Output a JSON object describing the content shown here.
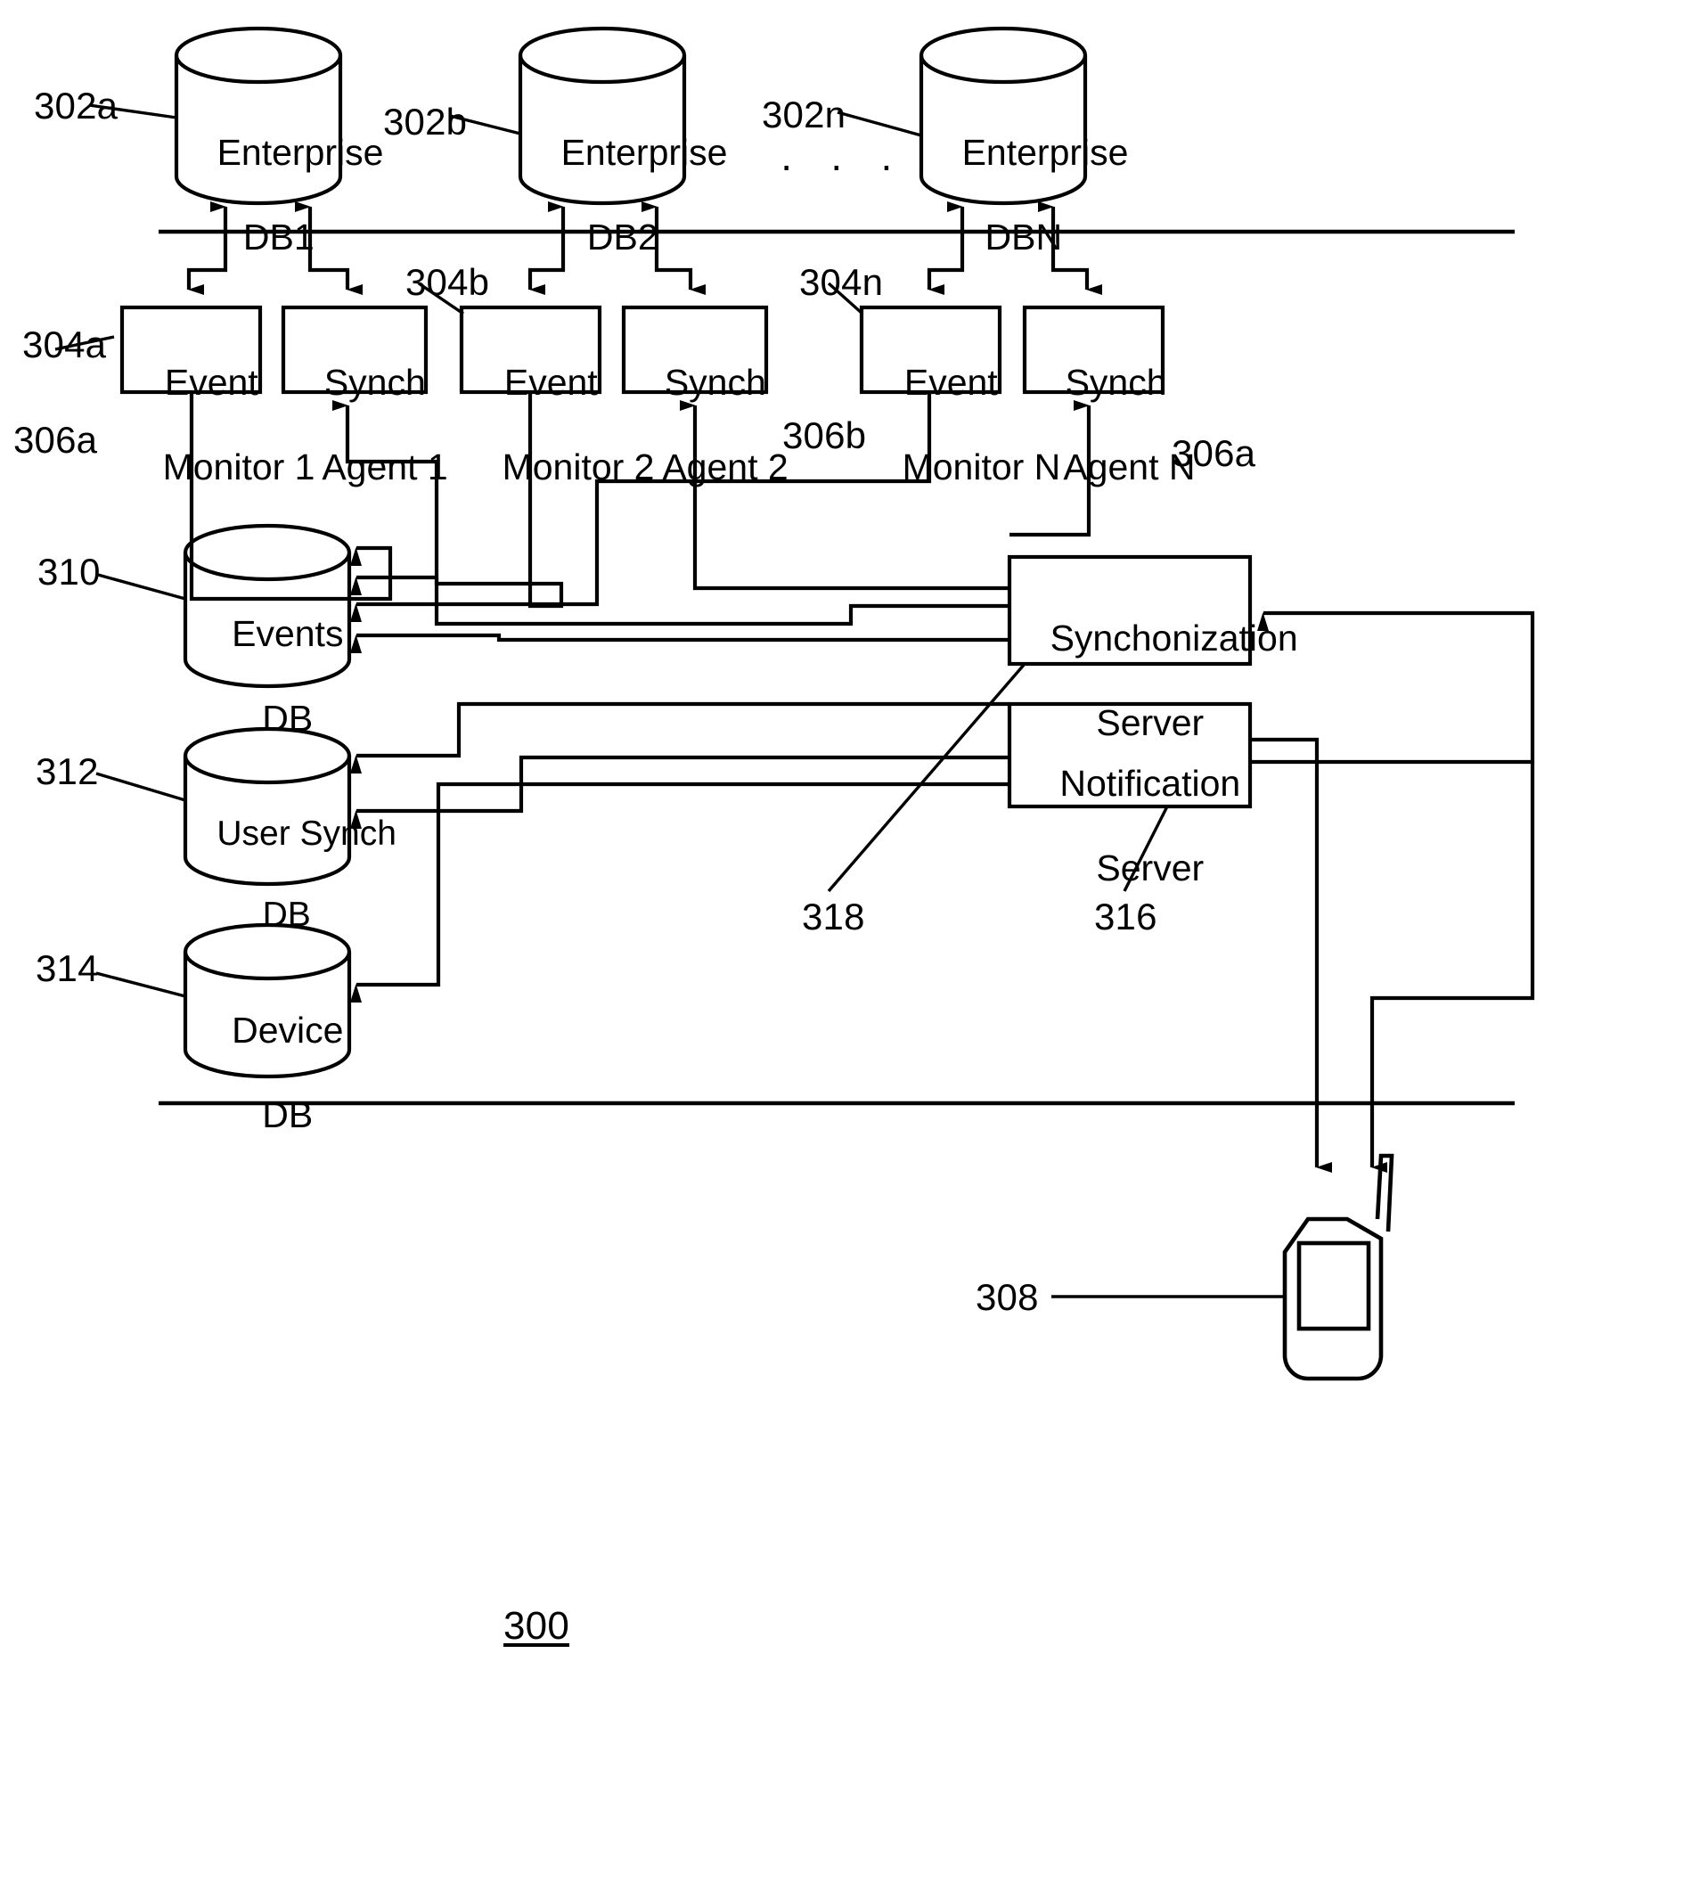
{
  "figure": {
    "number": "300",
    "ellipsis": "· · ·"
  },
  "enterprise_databases": [
    {
      "ref": "302a",
      "line1": "Enterprise",
      "line2": "DB1"
    },
    {
      "ref": "302b",
      "line1": "Enterprise",
      "line2": "DB2"
    },
    {
      "ref": "302n",
      "line1": "Enterprise",
      "line2": "DBN"
    }
  ],
  "agents": [
    {
      "ref": "304a",
      "line1": "Event",
      "line2": "Monitor 1"
    },
    {
      "ref": "",
      "line1": "Synch",
      "line2": "Agent 1"
    },
    {
      "ref": "304b",
      "line1": "Event",
      "line2": "Monitor 2"
    },
    {
      "ref": "",
      "line1": "Synch",
      "line2": "Agent 2"
    },
    {
      "ref": "304n",
      "line1": "Event",
      "line2": "Monitor N"
    },
    {
      "ref": "",
      "line1": "Synch",
      "line2": "Agent N"
    }
  ],
  "connector_refs": [
    {
      "ref": "306a"
    },
    {
      "ref": "306b"
    },
    {
      "ref": "306a"
    }
  ],
  "internal_databases": [
    {
      "ref": "310",
      "line1": "Events",
      "line2": "DB"
    },
    {
      "ref": "312",
      "line1": "User Synch",
      "line2": "DB"
    },
    {
      "ref": "314",
      "line1": "Device",
      "line2": "DB"
    }
  ],
  "servers": [
    {
      "ref": "318",
      "line1": "Synchonization",
      "line2": "Server"
    },
    {
      "ref": "316",
      "line1": "Notification",
      "line2": "Server"
    }
  ],
  "mobile_device": {
    "ref": "308"
  },
  "colors": {
    "stroke": "#000000",
    "background": "#ffffff"
  }
}
